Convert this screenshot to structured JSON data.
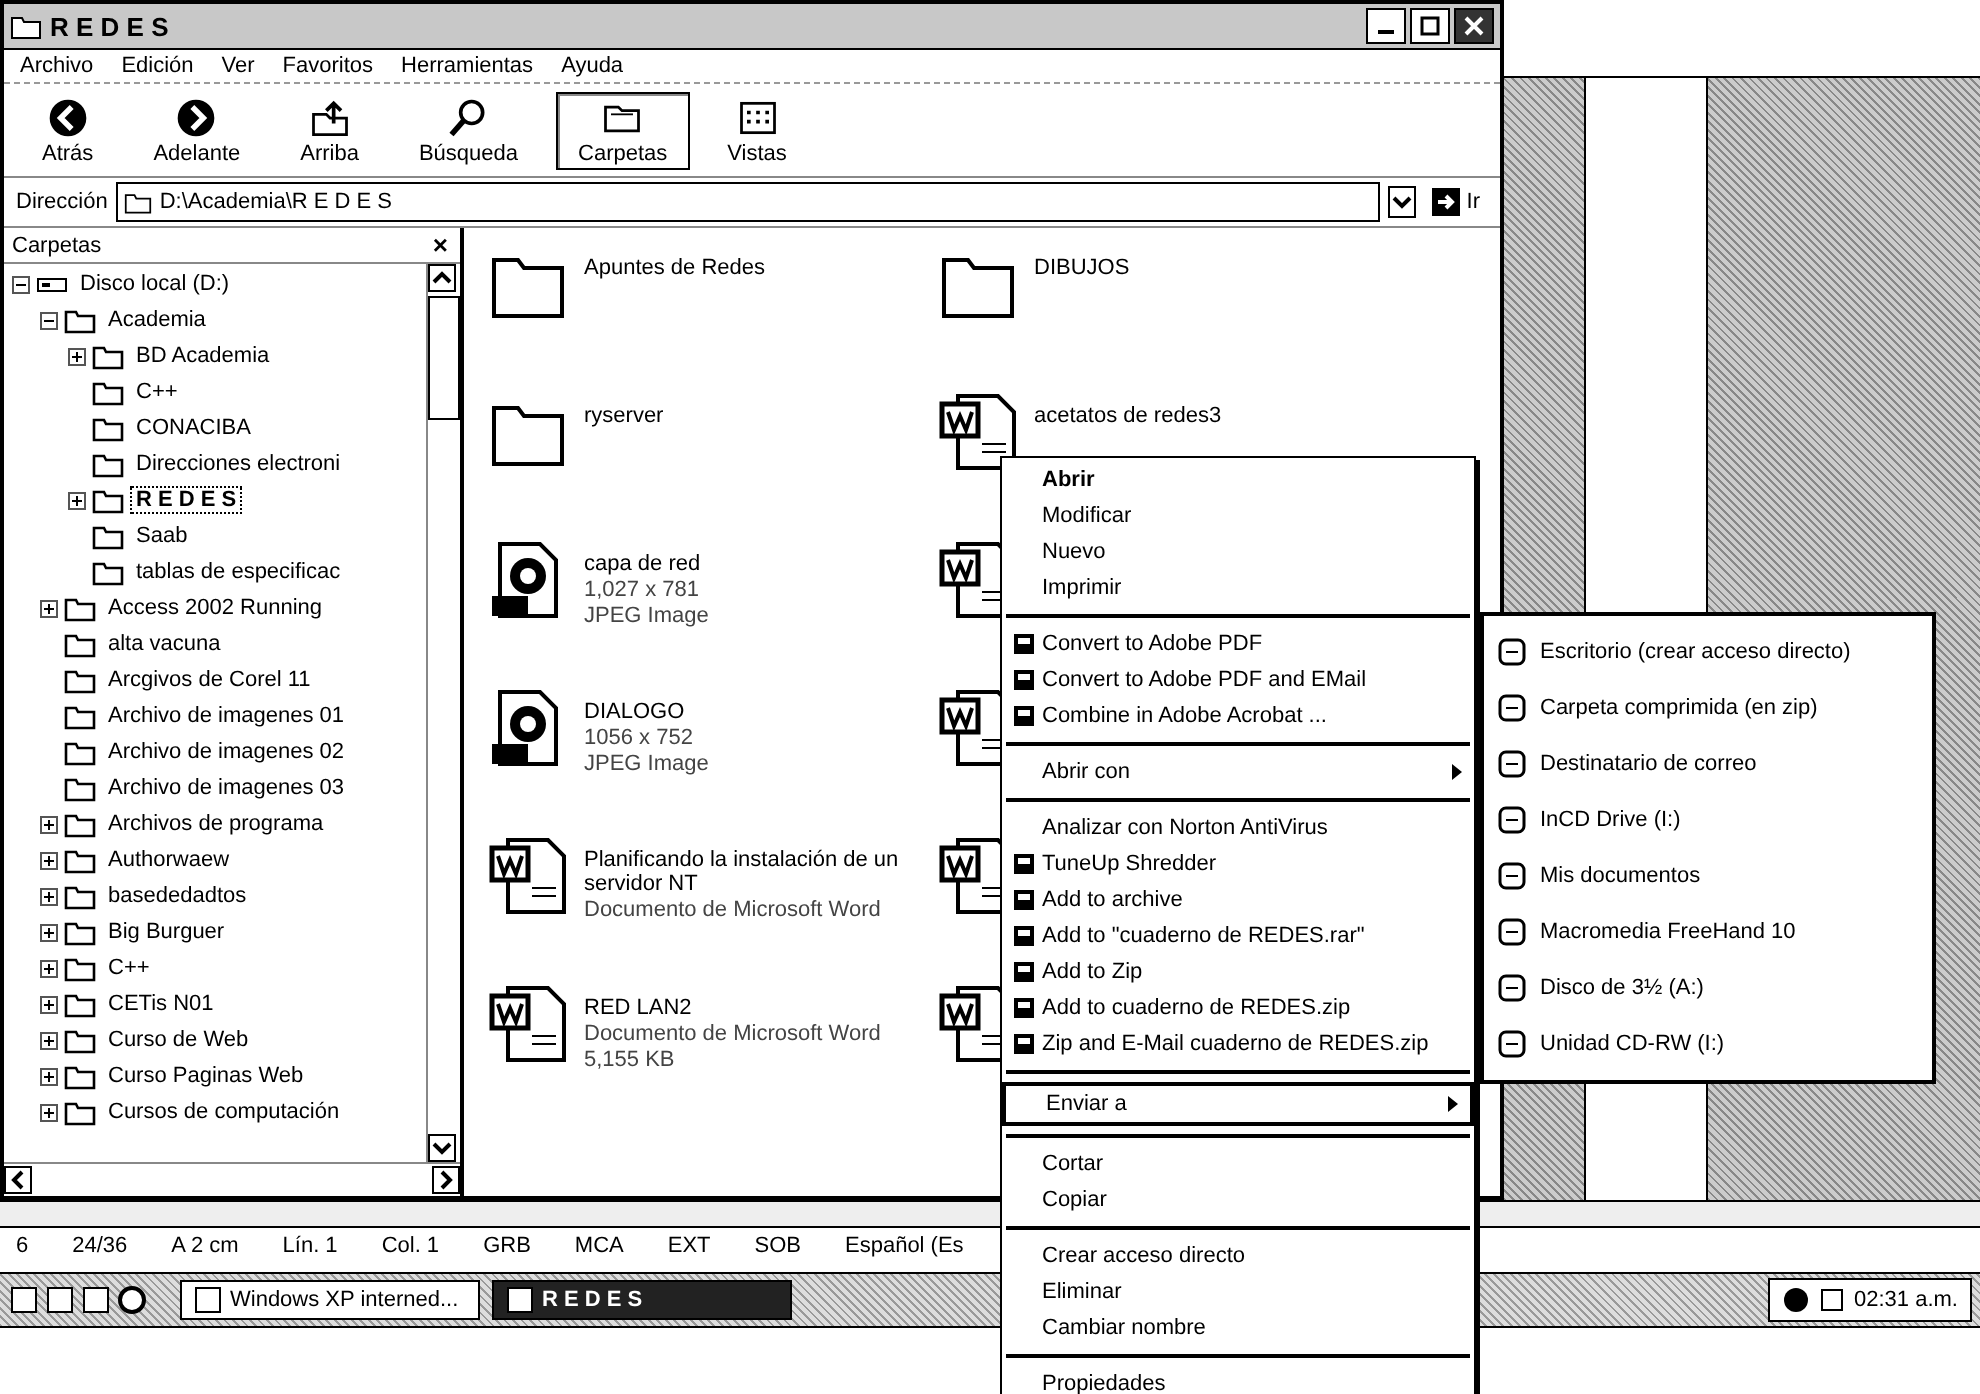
{
  "window": {
    "title": "R E D E S"
  },
  "menu_bar": [
    "Archivo",
    "Edición",
    "Ver",
    "Favoritos",
    "Herramientas",
    "Ayuda"
  ],
  "toolbar": [
    {
      "label": "Atrás",
      "kind": "back",
      "pressed": false
    },
    {
      "label": "Adelante",
      "kind": "forward",
      "pressed": false
    },
    {
      "label": "Arriba",
      "kind": "up",
      "pressed": false
    },
    {
      "label": "Búsqueda",
      "kind": "search",
      "pressed": false
    },
    {
      "label": "Carpetas",
      "kind": "folders",
      "pressed": true
    },
    {
      "label": "Vistas",
      "kind": "views",
      "pressed": false
    }
  ],
  "address_bar": {
    "label": "Dirección",
    "value": "D:\\Academia\\R E D E S",
    "go_button": "Ir"
  },
  "folders_pane": {
    "title": "Carpetas",
    "close": "×",
    "tree": [
      {
        "name": "Disco local (D:)",
        "kind": "open",
        "selected": false,
        "children": [
          {
            "name": "Academia",
            "kind": "open",
            "selected": false,
            "children": [
              {
                "name": "BD Academia",
                "kind": "closed",
                "selected": false
              },
              {
                "name": "C++",
                "kind": "leaf",
                "selected": false
              },
              {
                "name": "CONACIBA",
                "kind": "leaf",
                "selected": false
              },
              {
                "name": "Direcciones electroni",
                "kind": "leaf",
                "selected": false
              },
              {
                "name": "R E D E S",
                "kind": "closed",
                "selected": true
              },
              {
                "name": "Saab",
                "kind": "leaf",
                "selected": false
              },
              {
                "name": "tablas de especificac",
                "kind": "leaf",
                "selected": false
              }
            ]
          },
          {
            "name": "Access 2002 Running",
            "kind": "closed",
            "selected": false
          },
          {
            "name": "alta vacuna",
            "kind": "leaf",
            "selected": false
          },
          {
            "name": "Arcgivos de Corel 11",
            "kind": "leaf",
            "selected": false
          },
          {
            "name": "Archivo de imagenes 01",
            "kind": "leaf",
            "selected": false
          },
          {
            "name": "Archivo de imagenes 02",
            "kind": "leaf",
            "selected": false
          },
          {
            "name": "Archivo de imagenes 03",
            "kind": "leaf",
            "selected": false
          },
          {
            "name": "Archivos de programa",
            "kind": "closed",
            "selected": false
          },
          {
            "name": "Authorwaew",
            "kind": "closed",
            "selected": false
          },
          {
            "name": "basededadtos",
            "kind": "closed",
            "selected": false
          },
          {
            "name": "Big Burguer",
            "kind": "closed",
            "selected": false
          },
          {
            "name": "C++",
            "kind": "closed",
            "selected": false
          },
          {
            "name": "CETis N01",
            "kind": "closed",
            "selected": false
          },
          {
            "name": "Curso de Web",
            "kind": "closed",
            "selected": false
          },
          {
            "name": "Curso Paginas Web",
            "kind": "closed",
            "selected": false
          },
          {
            "name": "Cursos de computación",
            "kind": "closed",
            "selected": false
          }
        ]
      }
    ]
  },
  "files": [
    {
      "kind": "folder",
      "name": "Apuntes de Redes"
    },
    {
      "kind": "folder",
      "name": "DIBUJOS"
    },
    {
      "kind": "folder",
      "name": "ryserver"
    },
    {
      "kind": "word",
      "name": "acetatos de redes3"
    },
    {
      "kind": "jpeg",
      "name": "capa de red",
      "details": [
        "1,027 x 781",
        "JPEG Image"
      ]
    },
    {
      "kind": "word"
    },
    {
      "kind": "jpeg",
      "name": "DIALOGO",
      "details": [
        "1056 x 752",
        "JPEG Image"
      ]
    },
    {
      "kind": "word"
    },
    {
      "kind": "word",
      "name": "Planificando la instalación de un servidor NT",
      "details": [
        "Documento de Microsoft Word"
      ]
    },
    {
      "kind": "word"
    },
    {
      "kind": "word",
      "name": "RED LAN2",
      "details": [
        "Documento de Microsoft Word",
        "5,155 KB"
      ]
    },
    {
      "kind": "word"
    }
  ],
  "context_menu": [
    {
      "kind": "item",
      "label": "Abrir",
      "default": true,
      "icon": false,
      "submenu": false,
      "selected": false
    },
    {
      "kind": "item",
      "label": "Modificar",
      "default": false,
      "icon": false,
      "submenu": false,
      "selected": false
    },
    {
      "kind": "item",
      "label": "Nuevo",
      "default": false,
      "icon": false,
      "submenu": false,
      "selected": false
    },
    {
      "kind": "item",
      "label": "Imprimir",
      "default": false,
      "icon": false,
      "submenu": false,
      "selected": false
    },
    {
      "kind": "separator"
    },
    {
      "kind": "item",
      "label": "Convert to Adobe PDF",
      "default": false,
      "icon": true,
      "submenu": false,
      "selected": false
    },
    {
      "kind": "item",
      "label": "Convert to Adobe PDF and EMail",
      "default": false,
      "icon": true,
      "submenu": false,
      "selected": false
    },
    {
      "kind": "item",
      "label": "Combine in Adobe Acrobat ...",
      "default": false,
      "icon": true,
      "submenu": false,
      "selected": false
    },
    {
      "kind": "separator"
    },
    {
      "kind": "item",
      "label": "Abrir con",
      "default": false,
      "icon": false,
      "submenu": true,
      "selected": false
    },
    {
      "kind": "separator"
    },
    {
      "kind": "item",
      "label": "Analizar con Norton AntiVirus",
      "default": false,
      "icon": false,
      "submenu": false,
      "selected": false
    },
    {
      "kind": "item",
      "label": "TuneUp Shredder",
      "default": false,
      "icon": true,
      "submenu": false,
      "selected": false
    },
    {
      "kind": "item",
      "label": "Add to archive",
      "default": false,
      "icon": true,
      "submenu": false,
      "selected": false
    },
    {
      "kind": "item",
      "label": "Add to \"cuaderno de REDES.rar\"",
      "default": false,
      "icon": true,
      "submenu": false,
      "selected": false
    },
    {
      "kind": "item",
      "label": "Add to Zip",
      "default": false,
      "icon": true,
      "submenu": false,
      "selected": false
    },
    {
      "kind": "item",
      "label": "Add to cuaderno de REDES.zip",
      "default": false,
      "icon": true,
      "submenu": false,
      "selected": false
    },
    {
      "kind": "item",
      "label": "Zip and E-Mail cuaderno de REDES.zip",
      "default": false,
      "icon": true,
      "submenu": false,
      "selected": false
    },
    {
      "kind": "separator"
    },
    {
      "kind": "item",
      "label": "Enviar a",
      "default": false,
      "icon": false,
      "submenu": true,
      "selected": true
    },
    {
      "kind": "separator"
    },
    {
      "kind": "item",
      "label": "Cortar",
      "default": false,
      "icon": false,
      "submenu": false,
      "selected": false
    },
    {
      "kind": "item",
      "label": "Copiar",
      "default": false,
      "icon": false,
      "submenu": false,
      "selected": false
    },
    {
      "kind": "separator"
    },
    {
      "kind": "item",
      "label": "Crear acceso directo",
      "default": false,
      "icon": false,
      "submenu": false,
      "selected": false
    },
    {
      "kind": "item",
      "label": "Eliminar",
      "default": false,
      "icon": false,
      "submenu": false,
      "selected": false
    },
    {
      "kind": "item",
      "label": "Cambiar nombre",
      "default": false,
      "icon": false,
      "submenu": false,
      "selected": false
    },
    {
      "kind": "separator"
    },
    {
      "kind": "item",
      "label": "Propiedades",
      "default": false,
      "icon": false,
      "submenu": false,
      "selected": false
    }
  ],
  "send_to_menu": [
    "Escritorio (crear acceso directo)",
    "Carpeta comprimida (en zip)",
    "Destinatario de correo",
    "InCD Drive  (I:)",
    "Mis documentos",
    "Macromedia FreeHand 10",
    "Disco de 3½ (A:)",
    "Unidad CD-RW (I:)"
  ],
  "word_status_bar": [
    "6",
    "24/36",
    "A 2 cm",
    "Lín. 1",
    "Col. 1",
    "GRB",
    "MCA",
    "EXT",
    "SOB",
    "Español (Es"
  ],
  "taskbar": {
    "buttons": [
      {
        "label": "Windows XP interned...",
        "selected": false
      },
      {
        "label": "R E D E S",
        "selected": true
      }
    ],
    "clock": "02:31 a.m."
  }
}
